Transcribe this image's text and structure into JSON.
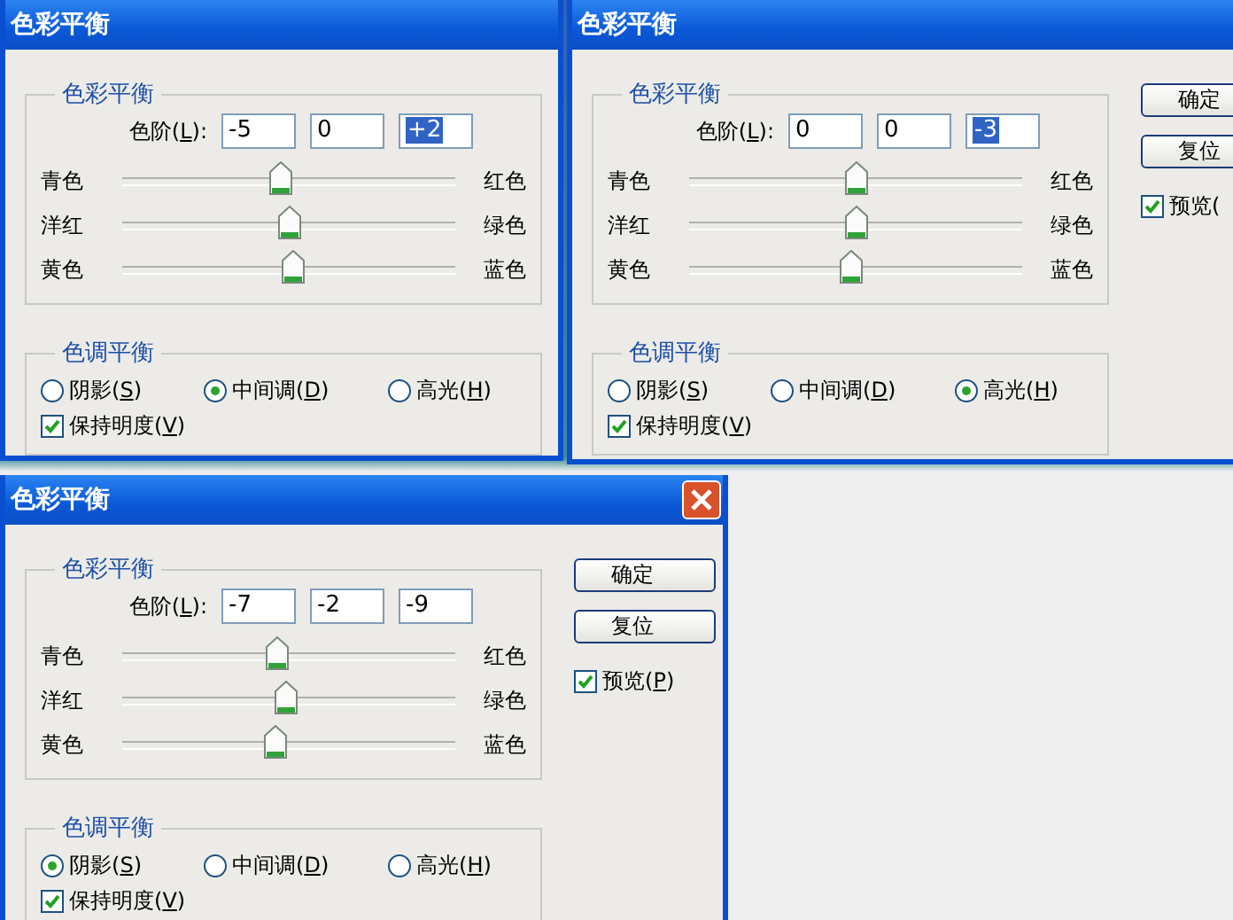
{
  "dialogs": [
    {
      "title": "色彩平衡",
      "color_balance": {
        "heading": "色彩平衡",
        "levels_label": "色阶(L):",
        "levels": [
          {
            "value": "-5",
            "highlighted": false
          },
          {
            "value": "0",
            "highlighted": false
          },
          {
            "value": "+2",
            "highlighted": true
          }
        ],
        "sliders": [
          {
            "left": "青色",
            "right": "红色",
            "level": 0.475
          },
          {
            "left": "洋红",
            "right": "绿色",
            "level": 0.5
          },
          {
            "left": "黄色",
            "right": "蓝色",
            "level": 0.51
          }
        ]
      },
      "tone_balance": {
        "heading": "色调平衡",
        "options": [
          {
            "label": "阴影(S)",
            "selected": false
          },
          {
            "label": "中间调(D)",
            "selected": true
          },
          {
            "label": "高光(H)",
            "selected": false
          }
        ],
        "preserve": {
          "label": "保持明度(V)",
          "checked": true
        }
      }
    },
    {
      "title": "色彩平衡",
      "color_balance": {
        "heading": "色彩平衡",
        "levels_label": "色阶(L):",
        "levels": [
          {
            "value": "0",
            "highlighted": false
          },
          {
            "value": "0",
            "highlighted": false
          },
          {
            "value": "-3",
            "highlighted": true
          }
        ],
        "sliders": [
          {
            "left": "青色",
            "right": "红色",
            "level": 0.5
          },
          {
            "left": "洋红",
            "right": "绿色",
            "level": 0.5
          },
          {
            "left": "黄色",
            "right": "蓝色",
            "level": 0.485
          }
        ]
      },
      "tone_balance": {
        "heading": "色调平衡",
        "options": [
          {
            "label": "阴影(S)",
            "selected": false
          },
          {
            "label": "中间调(D)",
            "selected": false
          },
          {
            "label": "高光(H)",
            "selected": true
          }
        ],
        "preserve": {
          "label": "保持明度(V)",
          "checked": true
        }
      },
      "buttons": [
        "确定",
        "复位"
      ],
      "preview": {
        "label": "预览(",
        "checked": true
      }
    },
    {
      "title": "色彩平衡",
      "close_button": true,
      "color_balance": {
        "heading": "色彩平衡",
        "levels_label": "色阶(L):",
        "levels": [
          {
            "value": "-7",
            "highlighted": false
          },
          {
            "value": "-2",
            "highlighted": false
          },
          {
            "value": "-9",
            "highlighted": false
          }
        ],
        "sliders": [
          {
            "left": "青色",
            "right": "红色",
            "level": 0.465
          },
          {
            "left": "洋红",
            "right": "绿色",
            "level": 0.49
          },
          {
            "left": "黄色",
            "right": "蓝色",
            "level": 0.455
          }
        ]
      },
      "tone_balance": {
        "heading": "色调平衡",
        "options": [
          {
            "label": "阴影(S)",
            "selected": true
          },
          {
            "label": "中间调(D)",
            "selected": false
          },
          {
            "label": "高光(H)",
            "selected": false
          }
        ],
        "preserve": {
          "label": "保持明度(V)",
          "checked": true
        }
      },
      "buttons": [
        "确定",
        "复位"
      ],
      "preview": {
        "label": "预览(P)",
        "checked": true
      }
    }
  ]
}
